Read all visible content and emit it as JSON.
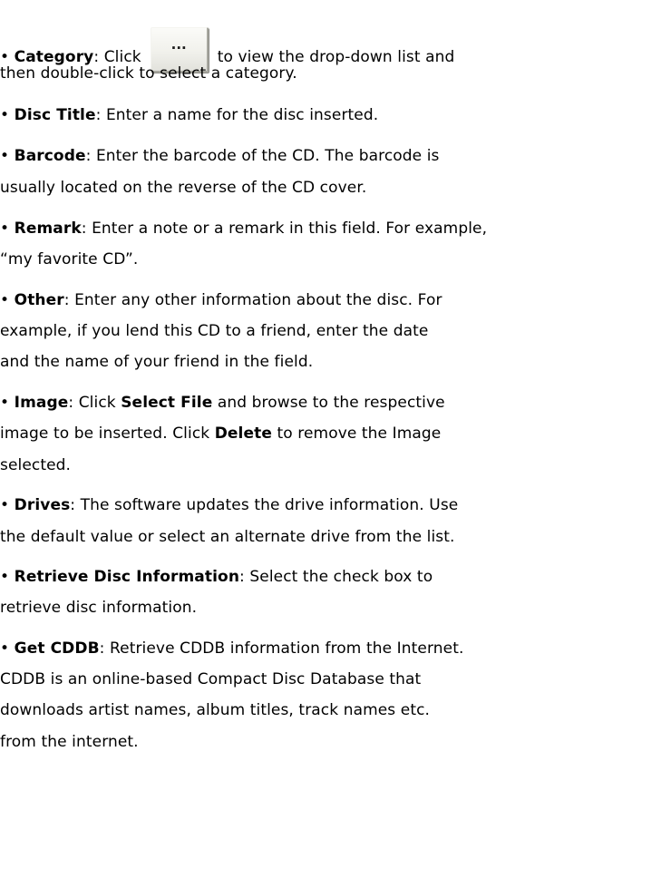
{
  "bullet": "•",
  "items": [
    {
      "term": "Category",
      "sep": ": ",
      "click_prefix": "Click",
      "button_glyph": "...",
      "lines": [
        "to view the drop-down list and",
        "then double-click to select a category."
      ]
    },
    {
      "term": "Disc Title",
      "sep": ": ",
      "lines": [
        "Enter a name for the disc inserted."
      ]
    },
    {
      "term": "Barcode",
      "sep": ": ",
      "lines": [
        "Enter the barcode of the CD. The barcode is",
        "usually located on the reverse of the CD cover."
      ]
    },
    {
      "term": "Remark",
      "sep": ": ",
      "lines": [
        "Enter a note or a remark in this field. For example,",
        "“my favorite CD”."
      ]
    },
    {
      "term": "Other",
      "sep": ": ",
      "lines": [
        "Enter any other information about the disc. For",
        "example, if you lend this CD to a friend, enter the date",
        "and the name of your friend in the field."
      ]
    },
    {
      "term": "Image",
      "sep": ": ",
      "line1_a": "Click ",
      "select_file": "Select File",
      "line1_b": " and browse to the respective",
      "line2_a": "image to be inserted. Click ",
      "delete": "Delete",
      "line2_b": " to remove the Image",
      "line3": "selected."
    },
    {
      "term": "Drives",
      "sep": ": ",
      "lines": [
        "The software updates the drive information. Use",
        "the default value or select an alternate drive from the list."
      ]
    },
    {
      "term": "Retrieve Disc Information",
      "sep": ": ",
      "lines": [
        "Select the check box to",
        "retrieve disc information."
      ]
    },
    {
      "term": "Get CDDB",
      "sep": ": ",
      "lines": [
        "Retrieve CDDB information from the Internet.",
        "CDDB is an online-based Compact Disc Database that",
        "downloads artist names, album titles, track names etc.",
        "from the internet."
      ]
    }
  ]
}
